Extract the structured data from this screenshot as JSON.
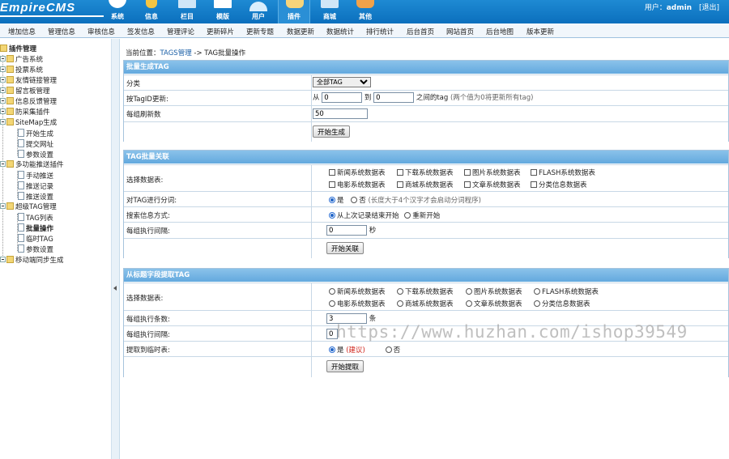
{
  "header": {
    "logo": "EmpireCMS",
    "nav": [
      {
        "label": "系统",
        "icon": "shield-icon",
        "color": "#ffffff"
      },
      {
        "label": "信息",
        "icon": "pencil-icon",
        "color": "#f4c542"
      },
      {
        "label": "栏目",
        "icon": "columns-icon",
        "color": "#cfe6f7"
      },
      {
        "label": "模版",
        "icon": "template-icon",
        "color": "#ffffff"
      },
      {
        "label": "用户",
        "icon": "user-icon",
        "color": "#d9eefc"
      },
      {
        "label": "插件",
        "icon": "plugin-icon",
        "color": "#f6d47b"
      },
      {
        "label": "商城",
        "icon": "shop-icon",
        "color": "#cfe6f7"
      },
      {
        "label": "其他",
        "icon": "other-icon",
        "color": "#f0a24a"
      }
    ],
    "user_prefix": "用户：",
    "username": "admin",
    "logout": "[退出]"
  },
  "subnav": [
    "增加信息",
    "管理信息",
    "审核信息",
    "签发信息",
    "管理评论",
    "更新碎片",
    "更新专题",
    "数据更新",
    "数据统计",
    "排行统计",
    "后台首页",
    "网站首页",
    "后台地图",
    "版本更新"
  ],
  "sidebar": {
    "root": "插件管理",
    "items": [
      {
        "label": "广告系统",
        "type": "folder"
      },
      {
        "label": "投票系统",
        "type": "folder"
      },
      {
        "label": "友情链接管理",
        "type": "folder"
      },
      {
        "label": "留言板管理",
        "type": "folder"
      },
      {
        "label": "信息反馈管理",
        "type": "folder"
      },
      {
        "label": "防采集插件",
        "type": "folder"
      },
      {
        "label": "SiteMap生成",
        "type": "folder-open"
      },
      {
        "label": "开始生成",
        "type": "doc"
      },
      {
        "label": "提交网址",
        "type": "doc"
      },
      {
        "label": "参数设置",
        "type": "doc"
      },
      {
        "label": "多功能推送插件",
        "type": "folder-open"
      },
      {
        "label": "手动推送",
        "type": "doc"
      },
      {
        "label": "推送记录",
        "type": "doc"
      },
      {
        "label": "推送设置",
        "type": "doc"
      },
      {
        "label": "超级TAG管理",
        "type": "folder-open"
      },
      {
        "label": "TAG列表",
        "type": "doc"
      },
      {
        "label": "批量操作",
        "type": "doc",
        "selected": true
      },
      {
        "label": "临时TAG",
        "type": "doc"
      },
      {
        "label": "参数设置",
        "type": "doc"
      },
      {
        "label": "移动端同步生成",
        "type": "folder"
      }
    ]
  },
  "location": {
    "prefix": "当前位置：",
    "link": "TAGS管理",
    "sep": " -> ",
    "current": "TAG批量操作"
  },
  "panel1": {
    "title": "批量生成TAG",
    "category_label": "分类",
    "category_value": "全部TAG",
    "by_id_label": "按TagID更新:",
    "from_text": "从",
    "from_value": "0",
    "to_text": "到",
    "to_value": "0",
    "between_text": "之间的tag",
    "between_hint": "(两个值为0将更新所有tag)",
    "per_group_label": "每组刷新数",
    "per_group_value": "50",
    "start_button": "开始生成"
  },
  "panel2": {
    "title": "TAG批量关联",
    "tables_label": "选择数据表:",
    "tables": [
      "新闻系统数据表",
      "下载系统数据表",
      "图片系统数据表",
      "FLASH系统数据表",
      "电影系统数据表",
      "商城系统数据表",
      "文章系统数据表",
      "分类信息数据表"
    ],
    "split_label": "对TAG进行分词:",
    "split_yes": "是",
    "split_no": "否",
    "split_hint": "(长度大于4个汉字才会启动分词程序)",
    "search_label": "搜索信息方式:",
    "search_opt1": "从上次记录结束开始",
    "search_opt2": "重新开始",
    "interval_label": "每组执行间隔:",
    "interval_value": "0",
    "interval_unit": "秒",
    "start_button": "开始关联"
  },
  "panel3": {
    "title": "从标题字段提取TAG",
    "tables_label": "选择数据表:",
    "tables": [
      "新闻系统数据表",
      "下载系统数据表",
      "图片系统数据表",
      "FLASH系统数据表",
      "电影系统数据表",
      "商城系统数据表",
      "文章系统数据表",
      "分类信息数据表"
    ],
    "count_label": "每组执行条数:",
    "count_value": "3",
    "count_unit": "条",
    "interval_label": "每组执行间隔:",
    "interval_value": "0",
    "temp_label": "提取到临时表:",
    "temp_yes": "是",
    "temp_yes_hint": "(建议)",
    "temp_no": "否",
    "start_button": "开始提取"
  },
  "watermark": "https://www.huzhan.com/ishop39549"
}
